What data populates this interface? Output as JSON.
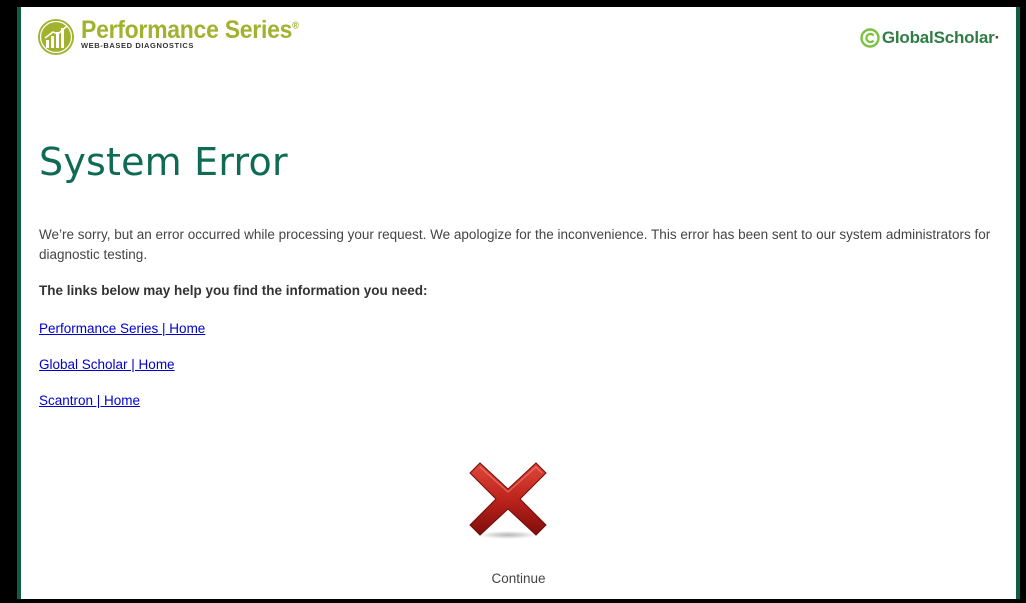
{
  "header": {
    "product_name": "Performance Series",
    "product_tagline": "WEB-BASED DIAGNOSTICS",
    "registered_mark": "®",
    "partner_name_main": "GlobalScholar",
    "partner_name_dot": "·"
  },
  "main": {
    "title": "System Error",
    "message": "We’re sorry, but an error occurred while processing your request. We apologize for the inconvenience. This error has been sent to our system administrators for diagnostic testing.",
    "links_heading": "The links below may help you find the information you need:",
    "links": [
      {
        "label": "Performance Series | Home"
      },
      {
        "label": "Global Scholar | Home"
      },
      {
        "label": "Scantron | Home"
      }
    ],
    "error_icon": "x-mark-icon",
    "continue_label": "Continue"
  },
  "colors": {
    "frame_border": "#0f5d43",
    "title": "#0f6b54",
    "brand_green": "#a1b22f",
    "link": "#0000cc",
    "error_red": "#c0231a"
  }
}
